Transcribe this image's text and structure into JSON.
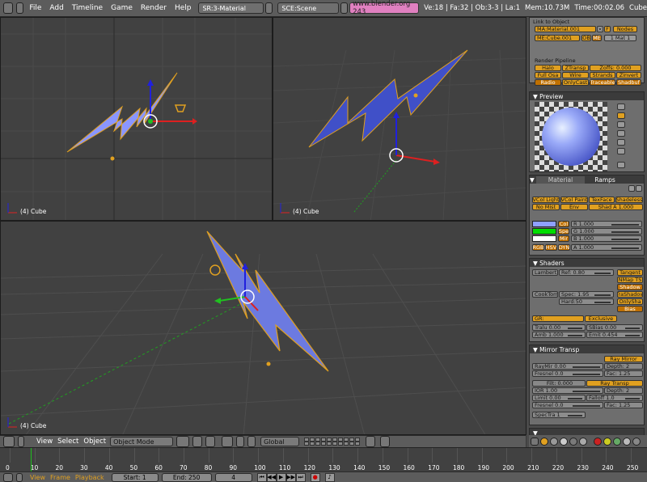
{
  "topbar": {
    "menus": [
      "File",
      "Add",
      "Timeline",
      "Game",
      "Render",
      "Help"
    ],
    "screen": "SR:3-Material",
    "scene": "SCE:Scene",
    "site": "www.blender.org 243",
    "stats": "Ve:18 | Fa:32 | Ob:3-3 | La:1",
    "mem": "Mem:10.73M",
    "time": "Time:00:02.06",
    "object": "Cube"
  },
  "viewports": {
    "top_left_label": "(4) Cube",
    "top_right_label": "(4) Cube",
    "bottom_label": "(4) Cube"
  },
  "view_header": {
    "menus": [
      "View",
      "Select",
      "Object"
    ],
    "mode": "Object Mode",
    "orientation": "Global"
  },
  "timeline": {
    "ticks": [
      "0",
      "10",
      "20",
      "30",
      "40",
      "50",
      "60",
      "70",
      "80",
      "90",
      "100",
      "110",
      "120",
      "130",
      "140",
      "150",
      "160",
      "170",
      "180",
      "190",
      "200",
      "210",
      "220",
      "230",
      "240",
      "250"
    ],
    "current_frame": 4
  },
  "bottombar": {
    "menus": [
      "View",
      "Frame",
      "Playback"
    ],
    "start": "Start: 1",
    "end": "End: 250",
    "frame": "4"
  },
  "link": {
    "title": "Link to Object",
    "material": "MA:Material.001",
    "f_label": "F",
    "nodes_label": "Nodes",
    "mesh": "ME:Cube.001",
    "ob_label": "OB",
    "me_label": "ME",
    "mat_count": "1 Mat 1"
  },
  "pipeline": {
    "title": "Render Pipeline",
    "buttons": [
      "Halo",
      "ZTransp",
      "Zoffs: 0.000",
      "Full Osa",
      "Wire",
      "Strands",
      "Zinvert",
      "Radio",
      "OnlyCast",
      "Traceable",
      "Shadbuf"
    ]
  },
  "preview": {
    "title": "Preview"
  },
  "material": {
    "tabs": [
      "Material",
      "Ramps"
    ],
    "row1": [
      "VCol Light",
      "VCol Paint",
      "TexFace",
      "Shadeless"
    ],
    "row2": [
      "No Mist",
      "Env",
      "Shad A 1.000"
    ],
    "col_label": "Col",
    "spe_label": "Spe",
    "mir_label": "Mir",
    "r": "R 1.000",
    "g": "G 1.000",
    "b": "B 1.000",
    "a": "A 1.000",
    "modes": [
      "RGB",
      "HSV",
      "DYN"
    ],
    "col_color": "#8fa0ff",
    "spe_color": "#00dd00",
    "mir_color": "#ffffff"
  },
  "shaders": {
    "title": "Shaders",
    "diffuse": "Lambert",
    "ref": "Ref: 0.80",
    "tangent": "Tangent",
    "nmap": "NMap TS",
    "shadow": "Shadow",
    "spec_shader": "CookTorr",
    "spec": "Spec: 1.95",
    "hard": "Hard:50",
    "tra_shadow": "TraShadow",
    "onlyshad": "OnlySha",
    "bias": "Bias",
    "gr": "GR:",
    "exclusive": "Exclusive",
    "tralu": "Tralu 0.00",
    "sbias": "SBias 0.00",
    "amb": "Amb 1.000",
    "emit": "Emit 0.454"
  },
  "mirror": {
    "title": "Mirror Transp",
    "ray_mirror": "Ray Mirror",
    "raymir": "RayMir 0.00",
    "depth1": "Depth: 2",
    "fresnel1": "Fresnel 0.0",
    "fac1": "Fac: 1.25",
    "filt": "Filt: 0.000",
    "ray_transp": "Ray Transp",
    "ior": "IOR 1.00",
    "depth2": "Depth: 2",
    "limit": "Limit 0.00",
    "falloff": "Falloff 1.0",
    "fresnel2": "Fresnel 0.0",
    "fac2": "Fac: 1.25",
    "spectra": "SpecTra 1"
  }
}
